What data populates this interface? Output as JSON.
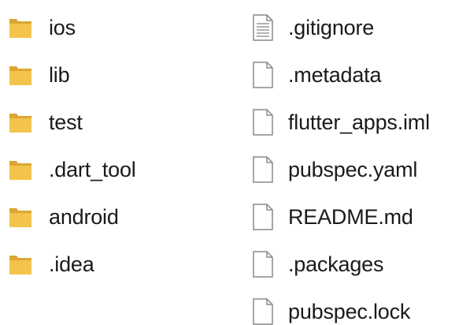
{
  "folders": [
    {
      "label": "ios",
      "icon": "folder-icon"
    },
    {
      "label": "lib",
      "icon": "folder-icon"
    },
    {
      "label": "test",
      "icon": "folder-icon"
    },
    {
      "label": ".dart_tool",
      "icon": "folder-icon"
    },
    {
      "label": "android",
      "icon": "folder-icon"
    },
    {
      "label": ".idea",
      "icon": "folder-icon"
    }
  ],
  "files": [
    {
      "label": ".gitignore",
      "icon": "text-file-icon"
    },
    {
      "label": ".metadata",
      "icon": "file-icon"
    },
    {
      "label": "flutter_apps.iml",
      "icon": "file-icon"
    },
    {
      "label": "pubspec.yaml",
      "icon": "file-icon"
    },
    {
      "label": "README.md",
      "icon": "file-icon"
    },
    {
      "label": ".packages",
      "icon": "file-icon"
    },
    {
      "label": "pubspec.lock",
      "icon": "file-icon"
    }
  ],
  "colors": {
    "folder_front": "#f3c44b",
    "folder_back": "#dca632",
    "file_outline": "#8a8a8a",
    "text": "#1a1a1a"
  }
}
